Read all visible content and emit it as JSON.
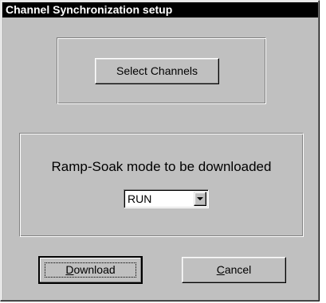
{
  "window": {
    "title": "Channel Synchronization setup"
  },
  "channels": {
    "select_label": "Select Channels"
  },
  "ramp_soak": {
    "heading": "Ramp-Soak mode to be downloaded",
    "mode_value": "RUN"
  },
  "actions": {
    "download_label": "Download",
    "download_mnemonic": "D",
    "download_rest": "ownload",
    "cancel_label": "Cancel",
    "cancel_mnemonic": "C",
    "cancel_rest": "ancel"
  },
  "colors": {
    "face": "#c0c0c0",
    "titlebar": "#000000"
  },
  "icons": {
    "combo_arrow": "chevron-down-icon"
  }
}
